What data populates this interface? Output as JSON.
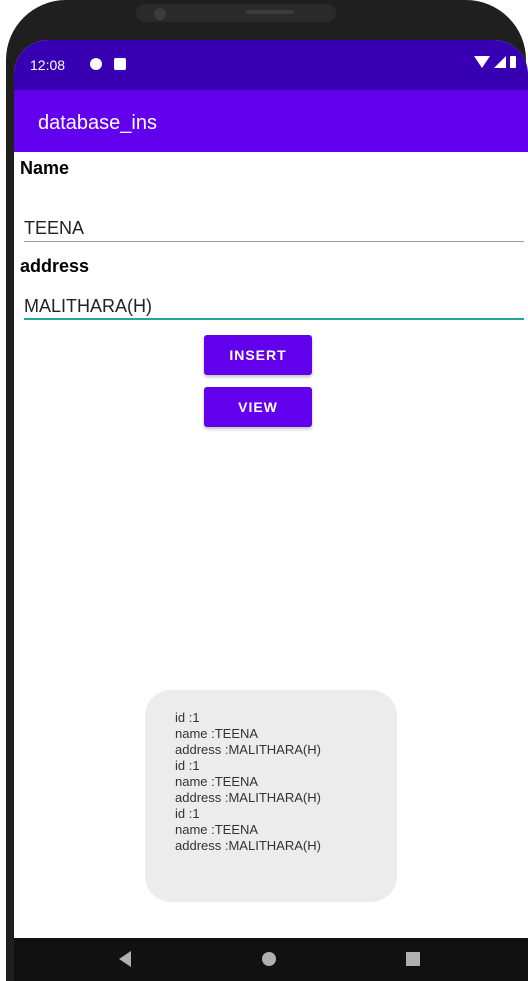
{
  "status_bar": {
    "time": "12:08"
  },
  "app_bar": {
    "title": "database_ins"
  },
  "form": {
    "name_label": "Name",
    "name_value": "TEENA",
    "address_label": "address",
    "address_value": "MALITHARA(H)"
  },
  "buttons": {
    "insert_label": "INSERT",
    "view_label": "VIEW"
  },
  "toast": {
    "lines": [
      "id :1",
      "name :TEENA",
      "address :MALITHARA(H)",
      "id :1",
      "name :TEENA",
      "address :MALITHARA(H)",
      "id :1",
      "name :TEENA",
      "address :MALITHARA(H)"
    ]
  },
  "colors": {
    "status_bar": "#3700b3",
    "app_bar": "#6200ee",
    "button": "#6200ee",
    "focused_underline": "#26a69a"
  },
  "icons": {
    "status_left": [
      "play-protect-icon",
      "sd-card-icon"
    ],
    "status_right": [
      "wifi-icon",
      "signal-icon",
      "battery-icon"
    ],
    "nav": [
      "back-icon",
      "home-icon",
      "recents-icon"
    ]
  }
}
